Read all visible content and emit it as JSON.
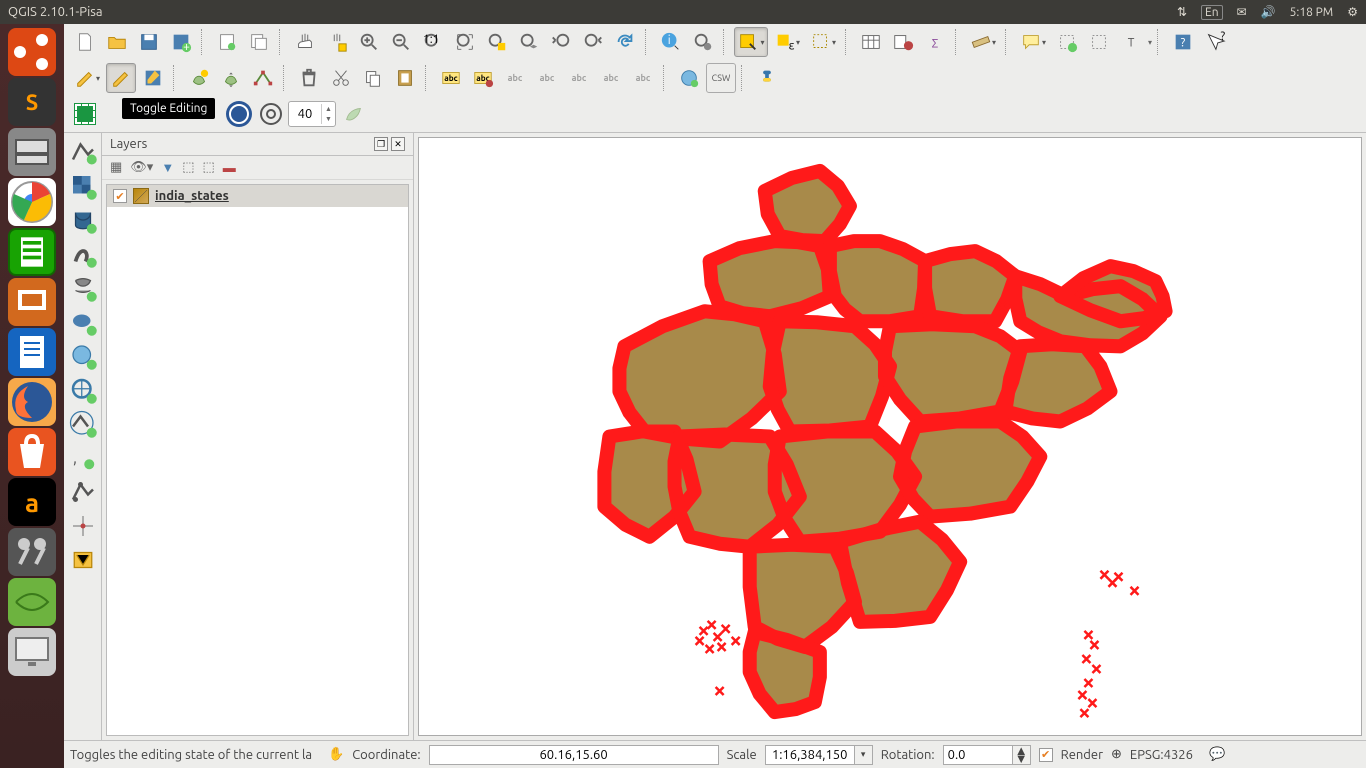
{
  "sysbar": {
    "title": "QGIS 2.10.1-Pisa",
    "lang": "En",
    "time": "5:18 PM"
  },
  "tooltip": "Toggle Editing",
  "layers": {
    "panel_title": "Layers",
    "items": [
      {
        "name": "india_states",
        "checked": true
      }
    ]
  },
  "plugin_spin": "40",
  "status": {
    "message": "Toggles the editing state of the current la",
    "coord_label": "Coordinate:",
    "coord": "60.16,15.60",
    "scale_label": "Scale",
    "scale": "1:16,384,150",
    "rotation_label": "Rotation:",
    "rotation": "0.0",
    "render_label": "Render",
    "epsg": "EPSG:4326"
  }
}
